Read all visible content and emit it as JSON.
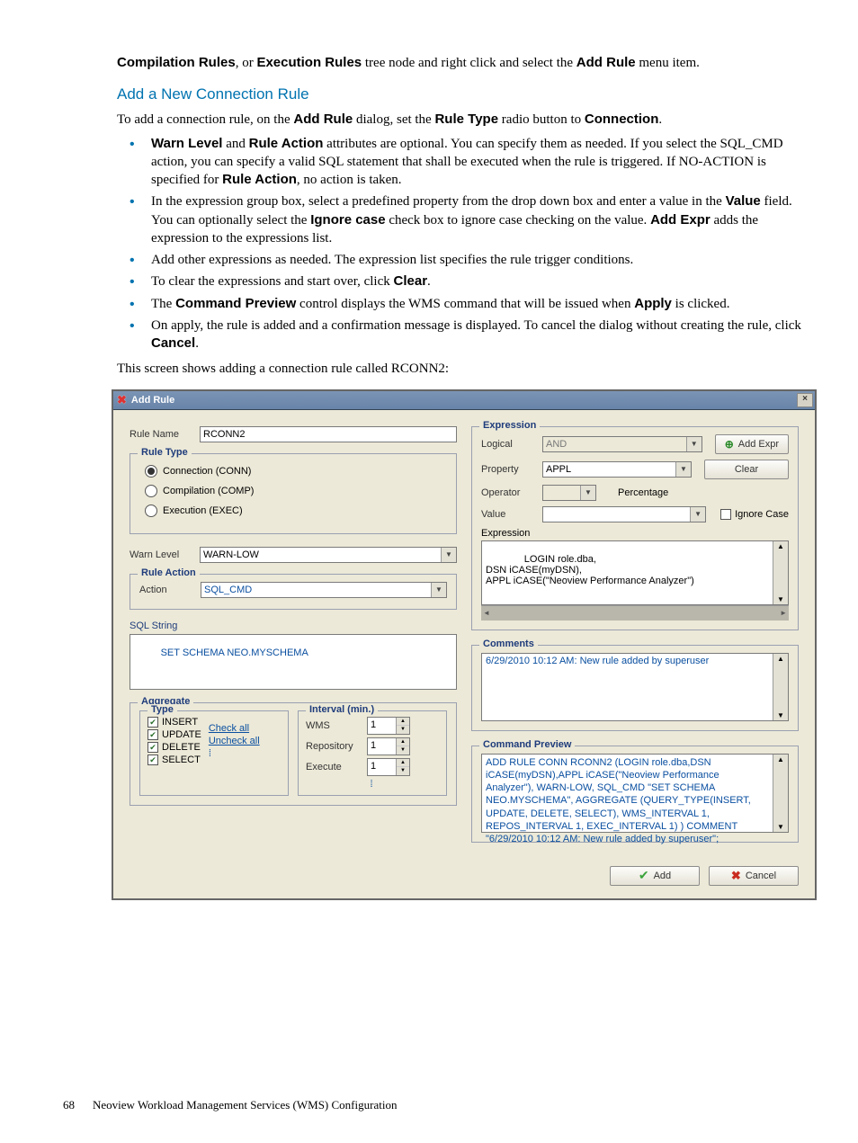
{
  "doc": {
    "intro_pre": "Compilation Rules",
    "intro_mid": ", or ",
    "intro_bold2": "Execution Rules",
    "intro_post": " tree node and right click and select the ",
    "intro_bold3": "Add Rule",
    "intro_end": " menu item.",
    "heading": "Add a New Connection Rule",
    "para1_a": "To add a connection rule, on the ",
    "para1_b": "Add Rule",
    "para1_c": " dialog, set the ",
    "para1_d": "Rule Type",
    "para1_e": " radio button to ",
    "para1_f": "Connection",
    "para1_g": ".",
    "b1_a": "Warn Level",
    "b1_b": " and ",
    "b1_c": "Rule Action",
    "b1_d": " attributes are optional. You can specify them as needed. If you select the SQL_CMD action, you can specify a valid SQL statement that shall be executed when the rule is triggered. If NO-ACTION is specified for ",
    "b1_e": "Rule Action",
    "b1_f": ", no action is taken.",
    "b2_a": "In the expression group box, select a predefined property from the drop down box and enter a value in the ",
    "b2_b": "Value",
    "b2_c": " field. You can optionally select the ",
    "b2_d": "Ignore case",
    "b2_e": " check box to ignore case checking on the value. ",
    "b2_f": "Add Expr",
    "b2_g": " adds the expression to the expressions list.",
    "b3": "Add other expressions as needed. The expression list specifies the rule trigger conditions.",
    "b4_a": "To clear the expressions and start over, click ",
    "b4_b": "Clear",
    "b4_c": ".",
    "b5_a": "The ",
    "b5_b": "Command Preview",
    "b5_c": " control displays the WMS command that will be issued when ",
    "b5_d": "Apply",
    "b5_e": " is clicked.",
    "b6_a": "On apply, the rule is added and a confirmation message is displayed. To cancel the dialog without creating the rule, click ",
    "b6_b": "Cancel",
    "b6_c": ".",
    "screen_note": "This screen shows adding a connection rule called RCONN2:"
  },
  "dialog": {
    "title": "Add Rule",
    "rule_name_label": "Rule Name",
    "rule_name_value": "RCONN2",
    "rule_type_legend": "Rule Type",
    "rt_conn": "Connection (CONN)",
    "rt_comp": "Compilation (COMP)",
    "rt_exec": "Execution (EXEC)",
    "warn_level_label": "Warn Level",
    "warn_level_value": "WARN-LOW",
    "rule_action_legend": "Rule Action",
    "action_label": "Action",
    "action_value": "SQL_CMD",
    "sql_string_label": "SQL String",
    "sql_string_value": "SET SCHEMA NEO.MYSCHEMA",
    "aggregate_legend": "Aggregate",
    "type_legend": "Type",
    "type_insert": "INSERT",
    "type_update": "UPDATE",
    "type_delete": "DELETE",
    "type_select": "SELECT",
    "check_all": "Check all",
    "uncheck_all": "Uncheck all",
    "interval_legend": "Interval (min.)",
    "int_wms": "WMS",
    "int_repo": "Repository",
    "int_exec": "Execute",
    "int_val": "1",
    "expression_legend": "Expression",
    "logical_label": "Logical",
    "logical_value": "AND",
    "property_label": "Property",
    "property_value": "APPL",
    "operator_label": "Operator",
    "percentage_label": "Percentage",
    "value_label": "Value",
    "ignore_case": "Ignore Case",
    "expression_sub": "Expression",
    "expr_text": "LOGIN role.dba,\nDSN iCASE(myDSN),\nAPPL iCASE(\"Neoview Performance Analyzer\")",
    "add_expr_btn": "Add Expr",
    "clear_btn": "Clear",
    "comments_legend": "Comments",
    "comments_text": "6/29/2010 10:12 AM: New rule added by superuser",
    "preview_legend": "Command Preview",
    "preview_text": "ADD RULE CONN RCONN2 (LOGIN role.dba,DSN iCASE(myDSN),APPL iCASE(\"Neoview Performance Analyzer\"), WARN-LOW, SQL_CMD \"SET SCHEMA NEO.MYSCHEMA\", AGGREGATE (QUERY_TYPE(INSERT, UPDATE, DELETE, SELECT), WMS_INTERVAL 1, REPOS_INTERVAL 1, EXEC_INTERVAL 1)  ) COMMENT \"6/29/2010 10:12 AM: New rule added by superuser\";",
    "add_btn": "Add",
    "cancel_btn": "Cancel"
  },
  "footer": {
    "page": "68",
    "title": "Neoview Workload Management Services (WMS) Configuration"
  }
}
